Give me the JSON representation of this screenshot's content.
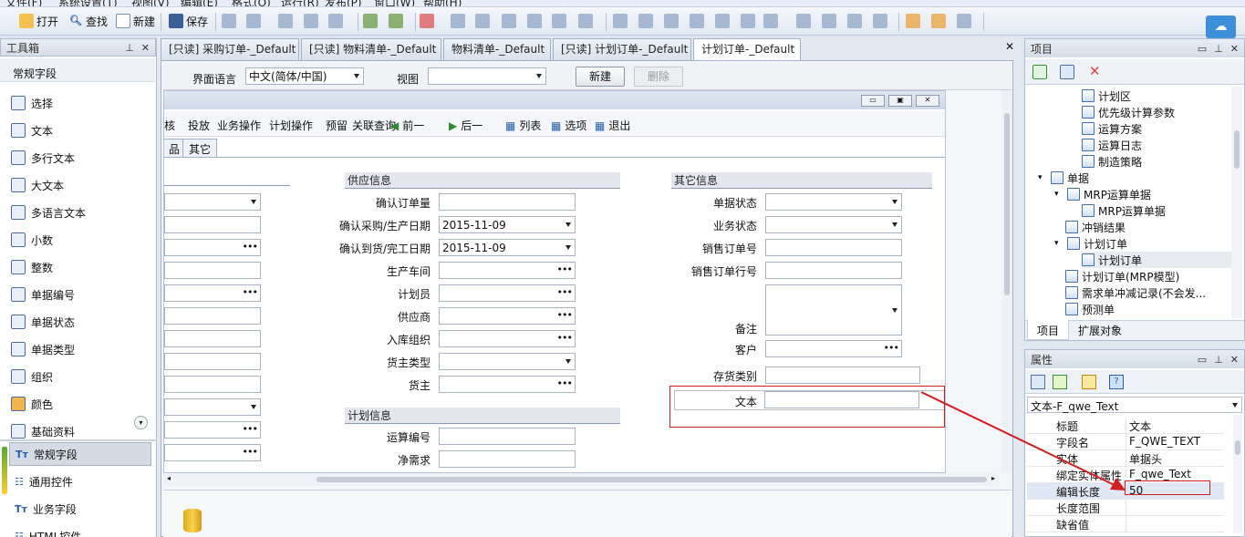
{
  "menubar": {
    "items": [
      "文件(F)",
      "系统设置(T)",
      "视图(V)",
      "编辑(E)",
      "格式(O)",
      "运行(R)",
      "发布(P)",
      "窗口(W)",
      "帮助(H)"
    ]
  },
  "toolbar": {
    "open": "打开",
    "find": "查找",
    "new": "新建",
    "save": "保存"
  },
  "toolbox": {
    "title": "工具箱",
    "section": "常规字段",
    "items": [
      "选择",
      "文本",
      "多行文本",
      "大文本",
      "多语言文本",
      "小数",
      "整数",
      "单据编号",
      "单据状态",
      "单据类型",
      "组织",
      "颜色",
      "基础资料"
    ],
    "groups": [
      "常规字段",
      "通用控件",
      "业务字段",
      "HTML控件"
    ]
  },
  "tabs": [
    "[只读] 采购订单-_Default",
    "[只读] 物料清单-_Default",
    "物料清单-_Default",
    "[只读] 计划订单-_Default",
    "计划订单-_Default"
  ],
  "filter": {
    "lang_label": "界面语言",
    "lang_value": "中文(简体/中国)",
    "view_label": "视图",
    "new_btn": "新建",
    "del_btn": "删除"
  },
  "form_toolbar": [
    "核",
    "投放",
    "业务操作",
    "计划操作",
    "预留",
    "关联查询",
    "前一",
    "后一",
    "列表",
    "选项",
    "退出"
  ],
  "subtabs": [
    "品",
    "其它"
  ],
  "supply": {
    "title": "供应信息",
    "fields": [
      {
        "label": "确认订单量",
        "value": "",
        "type": "text"
      },
      {
        "label": "确认采购/生产日期",
        "value": "2015-11-09",
        "type": "combo"
      },
      {
        "label": "确认到货/完工日期",
        "value": "2015-11-09",
        "type": "combo"
      },
      {
        "label": "生产车间",
        "value": "",
        "type": "lookup"
      },
      {
        "label": "计划员",
        "value": "",
        "type": "lookup"
      },
      {
        "label": "供应商",
        "value": "",
        "type": "lookup"
      },
      {
        "label": "入库组织",
        "value": "",
        "type": "lookup"
      },
      {
        "label": "货主类型",
        "value": "",
        "type": "combo"
      },
      {
        "label": "货主",
        "value": "",
        "type": "lookup"
      }
    ]
  },
  "plan": {
    "title": "计划信息",
    "fields": [
      {
        "label": "运算编号",
        "value": ""
      },
      {
        "label": "净需求",
        "value": ""
      }
    ]
  },
  "other": {
    "title": "其它信息",
    "fields": [
      {
        "label": "单据状态",
        "type": "combo"
      },
      {
        "label": "业务状态",
        "type": "combo"
      },
      {
        "label": "销售订单号",
        "type": "text"
      },
      {
        "label": "销售订单行号",
        "type": "text"
      },
      {
        "label": "备注",
        "type": "multi"
      },
      {
        "label": "客户",
        "type": "lookup"
      },
      {
        "label": "存货类别",
        "type": "text"
      }
    ],
    "new_text_label": "文本"
  },
  "project": {
    "title": "项目",
    "tree": [
      {
        "label": "计划区",
        "indent": 3
      },
      {
        "label": "优先级计算参数",
        "indent": 3
      },
      {
        "label": "运算方案",
        "indent": 3
      },
      {
        "label": "运算日志",
        "indent": 3
      },
      {
        "label": "制造策略",
        "indent": 3
      },
      {
        "label": "单据",
        "indent": 1,
        "expand": "▾"
      },
      {
        "label": "MRP运算单据",
        "indent": 2,
        "expand": "▾"
      },
      {
        "label": "MRP运算单据",
        "indent": 3
      },
      {
        "label": "冲销结果",
        "indent": 2
      },
      {
        "label": "计划订单",
        "indent": 2,
        "expand": "▾"
      },
      {
        "label": "计划订单",
        "indent": 3,
        "selected": true
      },
      {
        "label": "计划订单(MRP模型)",
        "indent": 2
      },
      {
        "label": "需求单冲减记录(不会发...",
        "indent": 2
      },
      {
        "label": "预测单",
        "indent": 2
      }
    ],
    "tabs": [
      "项目",
      "扩展对象"
    ]
  },
  "properties": {
    "title": "属性",
    "selector": "文本-F_qwe_Text",
    "rows": [
      {
        "k": "标题",
        "v": "文本"
      },
      {
        "k": "字段名",
        "v": "F_QWE_TEXT"
      },
      {
        "k": "实体",
        "v": "单据头"
      },
      {
        "k": "绑定实体属性",
        "v": "F_qwe_Text"
      },
      {
        "k": "编辑长度",
        "v": "50",
        "highlight": true
      },
      {
        "k": "长度范围",
        "v": ""
      },
      {
        "k": "缺省值",
        "v": ""
      }
    ]
  },
  "colors": {
    "accent": "#d11f1f",
    "panel": "#dfe7f2"
  }
}
